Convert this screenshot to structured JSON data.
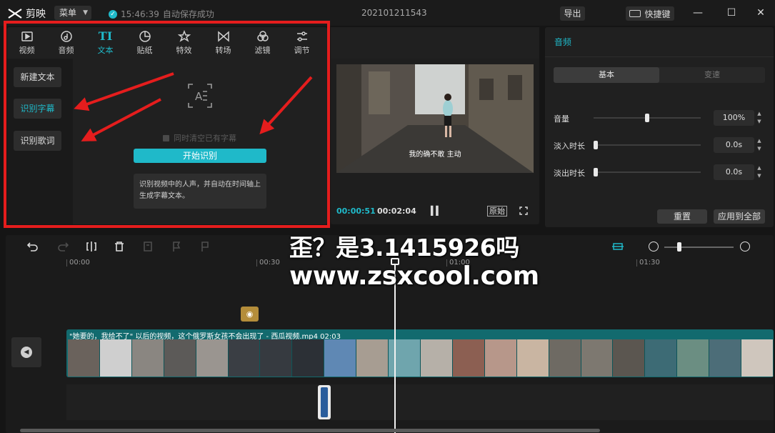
{
  "app": {
    "name": "剪映",
    "menu_label": "菜单",
    "save_time": "15:46:39",
    "save_status": "自动保存成功",
    "project_title": "202101211543",
    "export_label": "导出",
    "shortcut_label": "快捷键"
  },
  "toolbar": {
    "items": [
      {
        "label": "视频",
        "icon": "video-icon"
      },
      {
        "label": "音频",
        "icon": "audio-icon"
      },
      {
        "label": "文本",
        "icon": "text-icon",
        "active": true
      },
      {
        "label": "贴纸",
        "icon": "sticker-icon"
      },
      {
        "label": "特效",
        "icon": "effects-icon"
      },
      {
        "label": "转场",
        "icon": "transition-icon"
      },
      {
        "label": "滤镜",
        "icon": "filter-icon"
      },
      {
        "label": "调节",
        "icon": "adjust-icon"
      }
    ]
  },
  "side_menu": {
    "items": [
      "新建文本",
      "识别字幕",
      "识别歌词"
    ],
    "active_index": 1
  },
  "recognize": {
    "clear_existing": "同时清空已有字幕",
    "start_button": "开始识别",
    "description": "识别视频中的人声，并自动在时间轴上生成字幕文本。"
  },
  "player": {
    "subtitle": "我的确不敢 主动",
    "current_time": "00:00:51",
    "total_time": "00:02:04",
    "original_label": "原始"
  },
  "audio_panel": {
    "title": "音频",
    "tabs": [
      "基本",
      "变速"
    ],
    "active_tab": 0,
    "properties": [
      {
        "label": "音量",
        "value": "100%",
        "level": 0.5
      },
      {
        "label": "淡入时长",
        "value": "0.0s",
        "level": 0
      },
      {
        "label": "淡出时长",
        "value": "0.0s",
        "level": 0
      }
    ],
    "reset_label": "重置",
    "apply_all_label": "应用到全部"
  },
  "timeline": {
    "ruler_ticks": [
      "00:00",
      "00:30",
      "01:00",
      "01:30"
    ],
    "clip_title": "\"她要的，我给不了\" 以后的视频，这个俄罗斯女孩不会出现了 - 西瓜视频.mp4",
    "clip_duration": "02:03"
  },
  "watermark": {
    "line1": "歪？是3.1415926吗",
    "line2": "www.zsxcool.com"
  },
  "colors": {
    "accent": "#1fb9c9",
    "annotation": "#e51d1d",
    "clip": "#126a6e"
  }
}
